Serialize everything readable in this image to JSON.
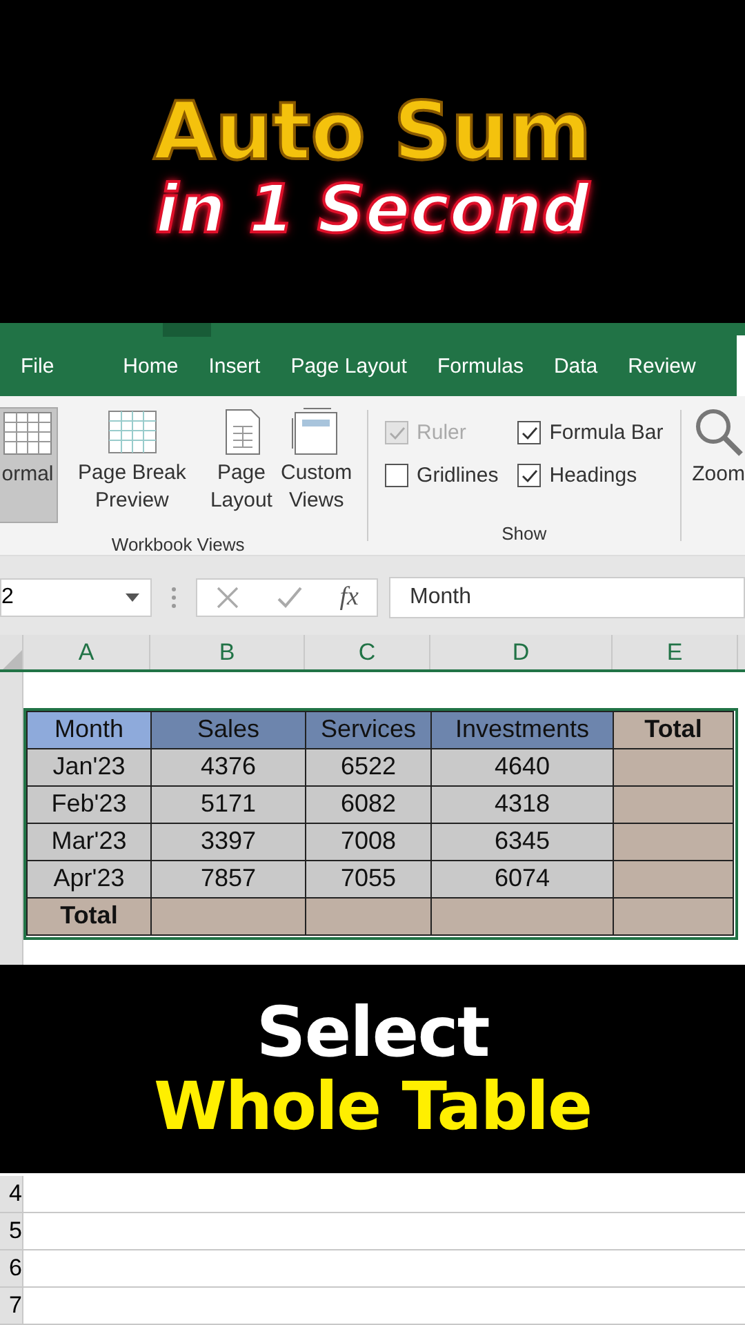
{
  "caption_top": {
    "line_1": "Auto Sum",
    "line_2": "in 1 Second"
  },
  "ribbon_tabs": [
    {
      "label": "File"
    },
    {
      "label": "Home"
    },
    {
      "label": "Insert"
    },
    {
      "label": "Page Layout"
    },
    {
      "label": "Formulas"
    },
    {
      "label": "Data"
    },
    {
      "label": "Review"
    }
  ],
  "workbook_views": {
    "label": "Workbook Views",
    "buttons": [
      {
        "label": "ormal",
        "kind": "normal",
        "selected": true
      },
      {
        "label": "Page Break Preview",
        "kind": "pagebreak",
        "selected": false
      },
      {
        "label": "Page Layout",
        "kind": "pagelayout",
        "selected": false
      },
      {
        "label": "Custom Views",
        "kind": "custom",
        "selected": false
      }
    ]
  },
  "show": {
    "label": "Show",
    "options": [
      {
        "label": "Ruler",
        "checked": true,
        "disabled": true
      },
      {
        "label": "Formula Bar",
        "checked": true,
        "disabled": false
      },
      {
        "label": "Gridlines",
        "checked": false,
        "disabled": false
      },
      {
        "label": "Headings",
        "checked": true,
        "disabled": false
      }
    ]
  },
  "zoom": {
    "label": "Zoom"
  },
  "formula_bar": {
    "name_box": "2",
    "function_label": "fx",
    "value": "Month"
  },
  "columns": [
    "A",
    "B",
    "C",
    "D",
    "E"
  ],
  "table": [
    {
      "cells": [
        {
          "text": "Month",
          "kind": "head-first"
        },
        {
          "text": "Sales",
          "kind": "head"
        },
        {
          "text": "Services",
          "kind": "head"
        },
        {
          "text": "Investments",
          "kind": "head"
        },
        {
          "text": "Total",
          "kind": "total"
        }
      ]
    },
    {
      "cells": [
        {
          "text": "Jan'23",
          "kind": "data"
        },
        {
          "text": "4376",
          "kind": "data"
        },
        {
          "text": "6522",
          "kind": "data"
        },
        {
          "text": "4640",
          "kind": "data"
        },
        {
          "text": "",
          "kind": "total"
        }
      ]
    },
    {
      "cells": [
        {
          "text": "Feb'23",
          "kind": "data"
        },
        {
          "text": "5171",
          "kind": "data"
        },
        {
          "text": "6082",
          "kind": "data"
        },
        {
          "text": "4318",
          "kind": "data"
        },
        {
          "text": "",
          "kind": "total"
        }
      ]
    },
    {
      "cells": [
        {
          "text": "Mar'23",
          "kind": "data"
        },
        {
          "text": "3397",
          "kind": "data"
        },
        {
          "text": "7008",
          "kind": "data"
        },
        {
          "text": "6345",
          "kind": "data"
        },
        {
          "text": "",
          "kind": "total"
        }
      ]
    },
    {
      "cells": [
        {
          "text": "Apr'23",
          "kind": "data"
        },
        {
          "text": "7857",
          "kind": "data"
        },
        {
          "text": "7055",
          "kind": "data"
        },
        {
          "text": "6074",
          "kind": "data"
        },
        {
          "text": "",
          "kind": "total"
        }
      ]
    },
    {
      "cells": [
        {
          "text": "Total",
          "kind": "total"
        },
        {
          "text": "",
          "kind": "total"
        },
        {
          "text": "",
          "kind": "total"
        },
        {
          "text": "",
          "kind": "total"
        },
        {
          "text": "",
          "kind": "total"
        }
      ]
    }
  ],
  "caption_bottom": {
    "line_1": "Select",
    "line_2": "Whole Table"
  },
  "row_numbers": [
    "4",
    "5",
    "6",
    "7"
  ]
}
